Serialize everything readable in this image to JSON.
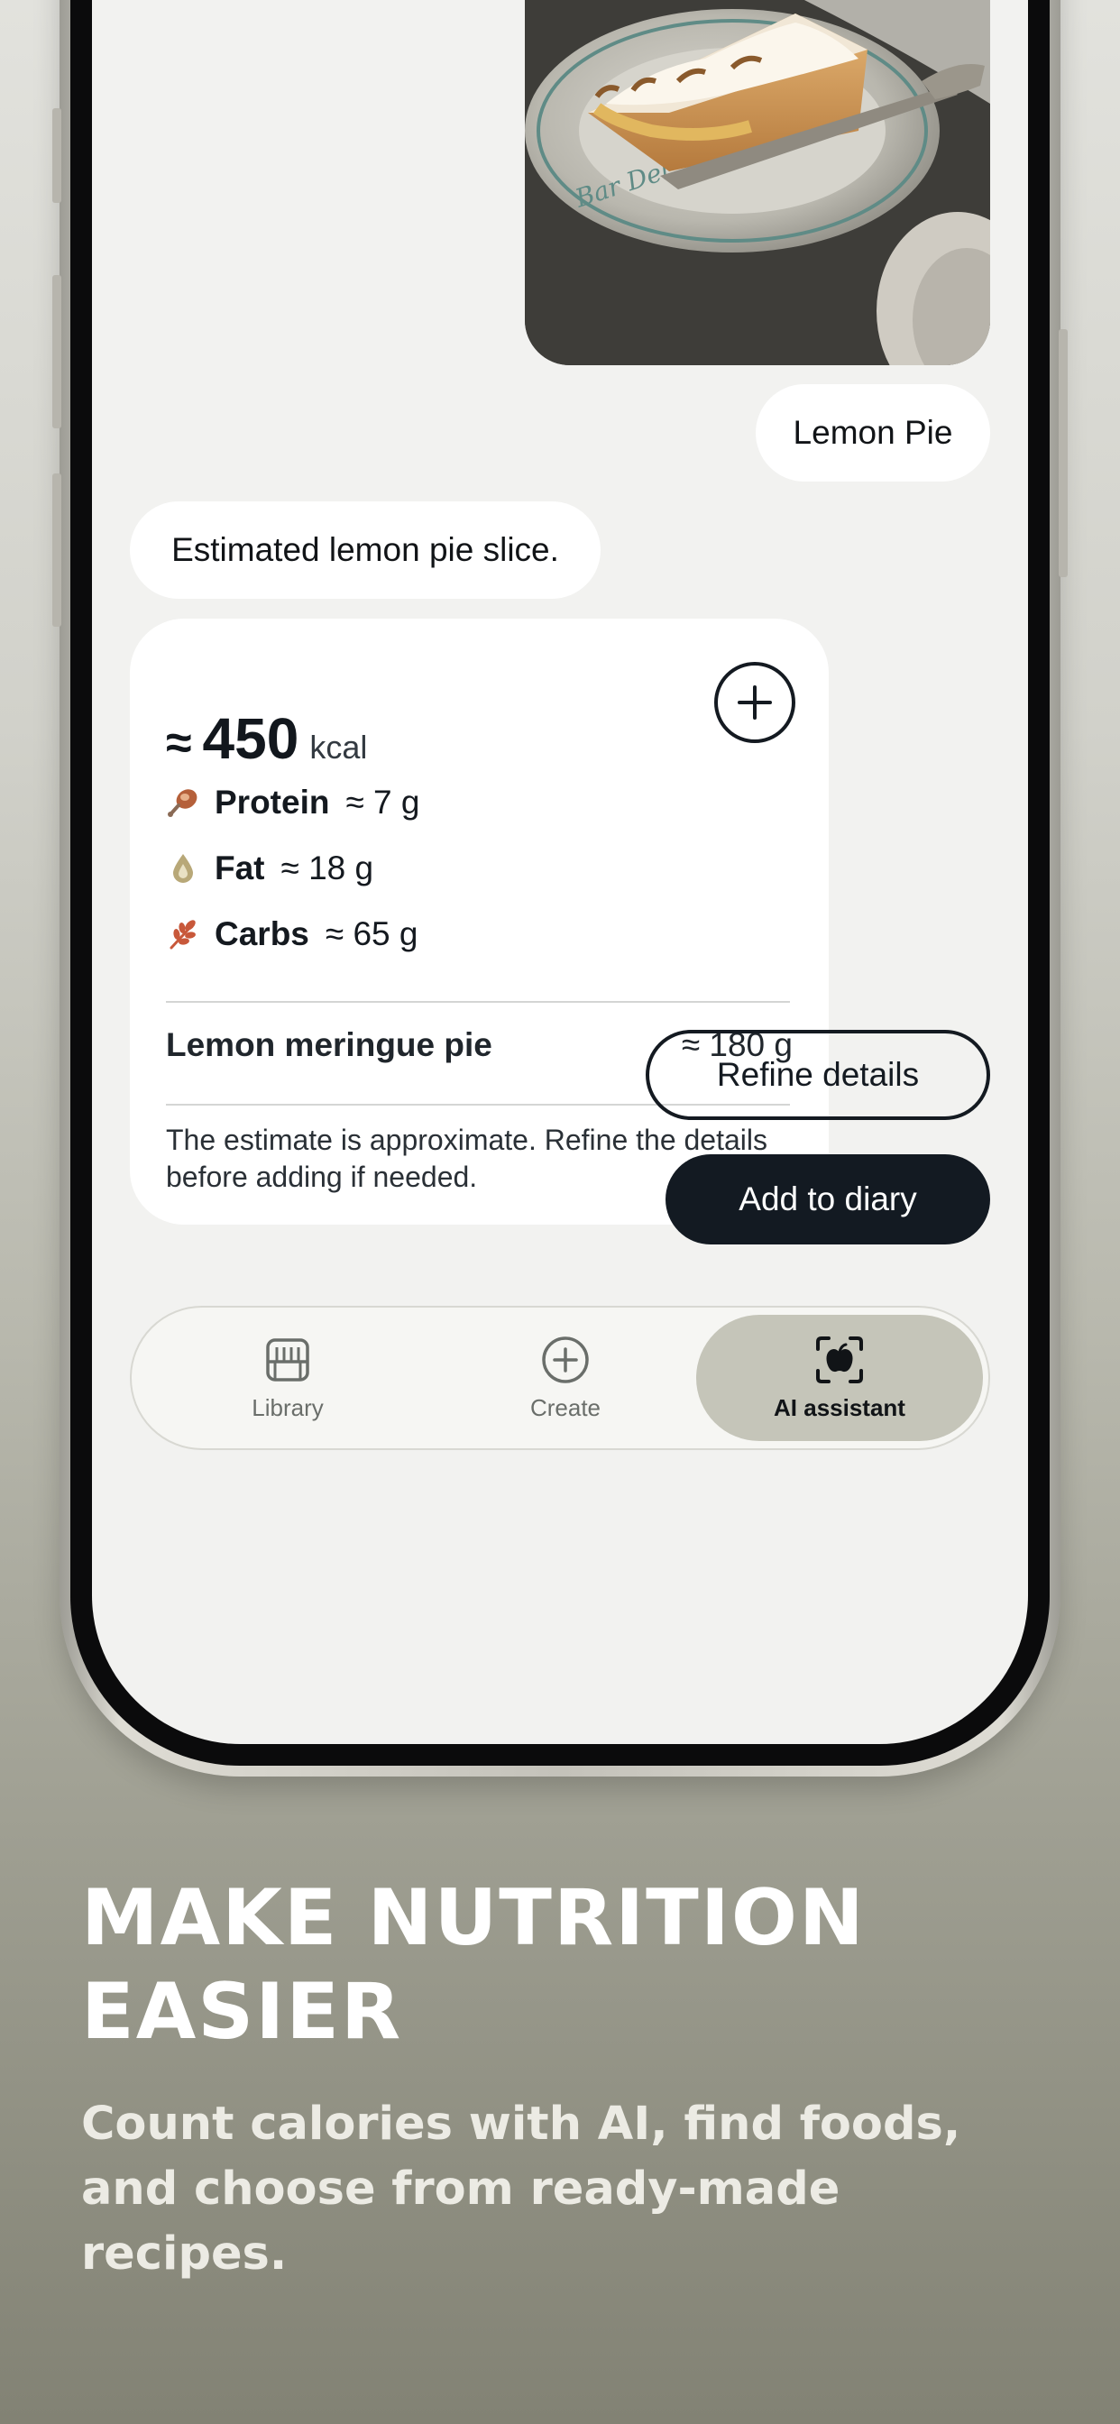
{
  "chat": {
    "user_message": "Lemon Pie",
    "assistant_message": "Estimated lemon pie slice."
  },
  "result_card": {
    "kcal_approx": "≈",
    "kcal_value": "450",
    "kcal_unit": "kcal",
    "macros": [
      {
        "name": "Protein",
        "value": "≈ 7 g",
        "icon": "drumstick-icon",
        "color": "#b5603a"
      },
      {
        "name": "Fat",
        "value": "≈ 18 g",
        "icon": "oil-drop-icon",
        "color": "#b8a878"
      },
      {
        "name": "Carbs",
        "value": "≈ 65 g",
        "icon": "wheat-icon",
        "color": "#c8583a"
      }
    ],
    "item": {
      "name": "Lemon meringue pie",
      "weight": "≈ 180 g"
    },
    "disclaimer": "The estimate is approximate. Refine the details before adding if needed."
  },
  "actions": {
    "refine_label": "Refine details",
    "add_label": "Add to diary"
  },
  "tab_bar": {
    "tabs": [
      {
        "label": "Library",
        "icon": "dishwasher-icon",
        "active": false
      },
      {
        "label": "Create",
        "icon": "plus-circle-icon",
        "active": false
      },
      {
        "label": "AI assistant",
        "icon": "camera-scan-icon",
        "active": true
      }
    ]
  },
  "marketing": {
    "headline": "MAKE NUTRITION EASIER",
    "subline": "Count calories with AI, find foods, and choose from ready-made recipes."
  },
  "colors": {
    "accent_dark": "#131a22",
    "screen_bg": "#f2f2f0",
    "active_tab": "#c5c5b9"
  }
}
